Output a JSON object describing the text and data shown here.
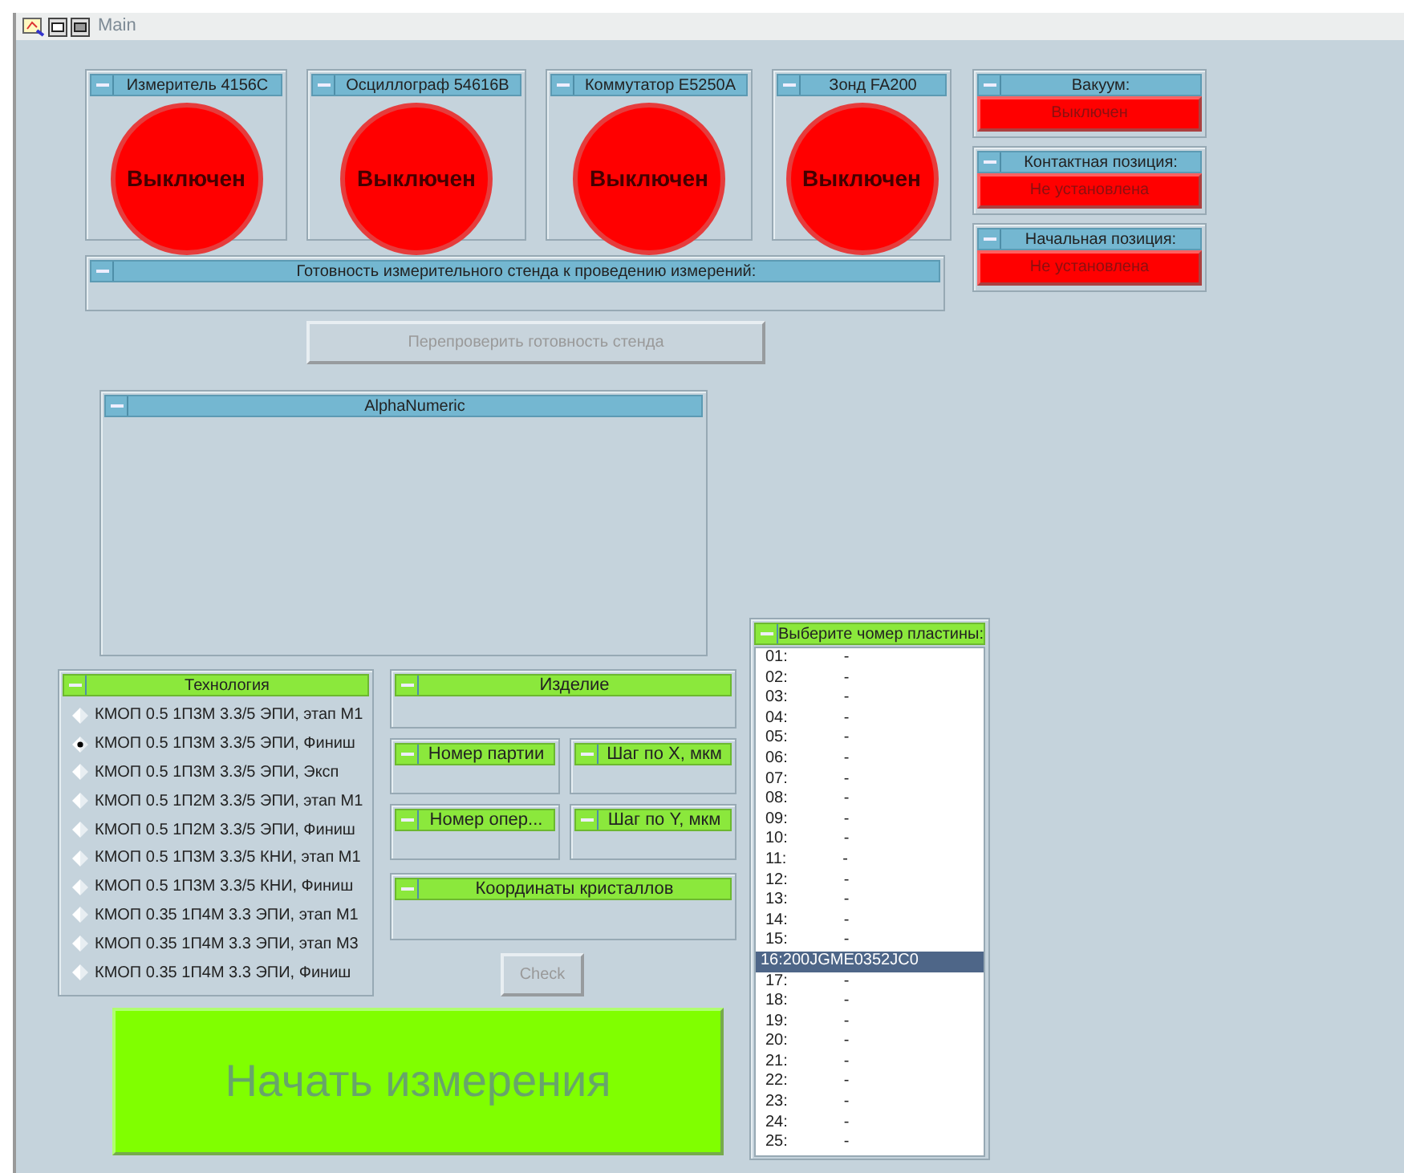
{
  "window": {
    "title": "Main"
  },
  "instruments": [
    {
      "title": "Измеритель 4156C",
      "status": "Выключен",
      "on": false
    },
    {
      "title": "Осциллограф 54616B",
      "status": "Выключен",
      "on": false
    },
    {
      "title": "Коммутатор E5250A",
      "status": "Выключен",
      "on": false
    },
    {
      "title": "Зонд FA200",
      "status": "Выключен",
      "on": false
    }
  ],
  "indicators": [
    {
      "title": "Вакуум:",
      "value": "Выключен",
      "ok": false
    },
    {
      "title": "Контактная позиция:",
      "value": "Не установлена",
      "ok": false
    },
    {
      "title": "Начальная позиция:",
      "value": "Не установлена",
      "ok": false
    }
  ],
  "readiness": {
    "title": "Готовность измерительного стенда к проведению измерений:"
  },
  "recheck_button": {
    "label": "Перепроверить готовность стенда",
    "disabled": true
  },
  "alphanumeric": {
    "title": "AlphaNumeric"
  },
  "technology": {
    "title": "Технология",
    "options": [
      {
        "label": "КМОП 0.5 1П3М 3.3/5 ЭПИ, этап М1",
        "selected": false
      },
      {
        "label": "КМОП 0.5 1П3М 3.3/5 ЭПИ, Финиш",
        "selected": true
      },
      {
        "label": "КМОП 0.5 1П3М 3.3/5 ЭПИ, Эксп",
        "selected": false
      },
      {
        "label": "КМОП 0.5 1П2М 3.3/5 ЭПИ, этап М1",
        "selected": false
      },
      {
        "label": "КМОП 0.5 1П2М 3.3/5 ЭПИ, Финиш",
        "selected": false
      },
      {
        "label": "КМОП 0.5 1П3М 3.3/5 КНИ, этап М1",
        "selected": false
      },
      {
        "label": "КМОП 0.5 1П3М 3.3/5 КНИ, Финиш",
        "selected": false
      },
      {
        "label": "КМОП 0.35 1П4М 3.3 ЭПИ, этап М1",
        "selected": false
      },
      {
        "label": "КМОП 0.35 1П4М 3.3 ЭПИ, этап М3",
        "selected": false
      },
      {
        "label": "КМОП 0.35 1П4М 3.3 ЭПИ, Финиш",
        "selected": false
      }
    ]
  },
  "fields": [
    {
      "title": "Изделие",
      "kind": "wide"
    },
    {
      "title": "Номер партии",
      "kind": "half"
    },
    {
      "title": "Шаг по X, мкм",
      "kind": "half"
    },
    {
      "title": "Номер опер...",
      "kind": "half"
    },
    {
      "title": "Шаг по Y, мкм",
      "kind": "half"
    },
    {
      "title": "Координаты кристаллов",
      "kind": "wide"
    }
  ],
  "check_button": {
    "label": "Check",
    "disabled": true
  },
  "start_button": {
    "label": "Начать измерения"
  },
  "wafers": {
    "title": "Выберите чомер пластины:",
    "items": [
      {
        "number": "01:",
        "value": "-",
        "selected": false
      },
      {
        "number": "02:",
        "value": "-",
        "selected": false
      },
      {
        "number": "03:",
        "value": "-",
        "selected": false
      },
      {
        "number": "04:",
        "value": "-",
        "selected": false
      },
      {
        "number": "05:",
        "value": "-",
        "selected": false
      },
      {
        "number": "06:",
        "value": "-",
        "selected": false
      },
      {
        "number": "07:",
        "value": "-",
        "selected": false
      },
      {
        "number": "08:",
        "value": "-",
        "selected": false
      },
      {
        "number": "09:",
        "value": "-",
        "selected": false
      },
      {
        "number": "10:",
        "value": "-",
        "selected": false
      },
      {
        "number": "11:",
        "value": "-",
        "selected": false
      },
      {
        "number": "12:",
        "value": "-",
        "selected": false
      },
      {
        "number": "13:",
        "value": "-",
        "selected": false
      },
      {
        "number": "14:",
        "value": "-",
        "selected": false
      },
      {
        "number": "15:",
        "value": "-",
        "selected": false
      },
      {
        "number": "16:",
        "value": "200JGME0352JC0",
        "selected": true
      },
      {
        "number": "17:",
        "value": "-",
        "selected": false
      },
      {
        "number": "18:",
        "value": "-",
        "selected": false
      },
      {
        "number": "19:",
        "value": "-",
        "selected": false
      },
      {
        "number": "20:",
        "value": "-",
        "selected": false
      },
      {
        "number": "21:",
        "value": "-",
        "selected": false
      },
      {
        "number": "22:",
        "value": "-",
        "selected": false
      },
      {
        "number": "23:",
        "value": "-",
        "selected": false
      },
      {
        "number": "24:",
        "value": "-",
        "selected": false
      },
      {
        "number": "25:",
        "value": "-",
        "selected": false
      }
    ]
  }
}
